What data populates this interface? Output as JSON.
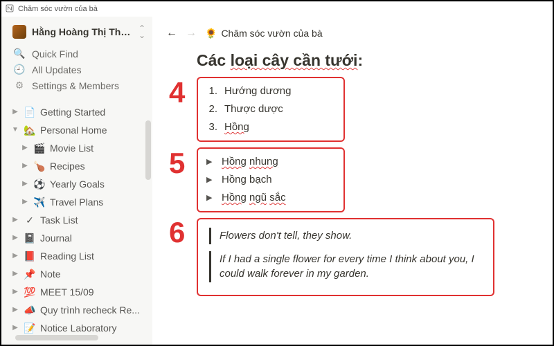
{
  "window": {
    "title": "Chăm sóc vườn của bà"
  },
  "workspace": {
    "title": "Hằng Hoàng Thị Thúy'..."
  },
  "sidebar_top": {
    "quick_find": "Quick Find",
    "all_updates": "All Updates",
    "settings": "Settings & Members"
  },
  "pages": {
    "getting_started": "Getting Started",
    "personal_home": "Personal Home",
    "movie_list": "Movie List",
    "recipes": "Recipes",
    "yearly_goals": "Yearly Goals",
    "travel_plans": "Travel Plans",
    "task_list": "Task List",
    "journal": "Journal",
    "reading_list": "Reading List",
    "note": "Note",
    "meet": "MEET 15/09",
    "quy_trinh": "Quy trình recheck Re...",
    "notice_lab": "Notice Laboratory"
  },
  "breadcrumb": {
    "emoji": "🌻",
    "title": "Chăm sóc vườn của bà"
  },
  "heading": {
    "pre": "Các ",
    "wavy": "loại cây cần tưới",
    "post": ":"
  },
  "numbered": {
    "n1": "1.",
    "i1": "Hướng dương",
    "n2": "2.",
    "i2": "Thược dược",
    "n3": "3.",
    "i3a": "Hồng"
  },
  "toggles": {
    "t1a": "Hồng",
    "t1b": "nhung",
    "t2": "Hồng bạch",
    "t3a": "Hồng",
    "t3b": "ngũ",
    "t3c": "sắc"
  },
  "quotes": {
    "q1": "Flowers don't tell, they show.",
    "q2": "If I had a single flower for every time I think about you, I could walk forever in my garden."
  },
  "annotations": {
    "a4": "4",
    "a5": "5",
    "a6": "6"
  }
}
